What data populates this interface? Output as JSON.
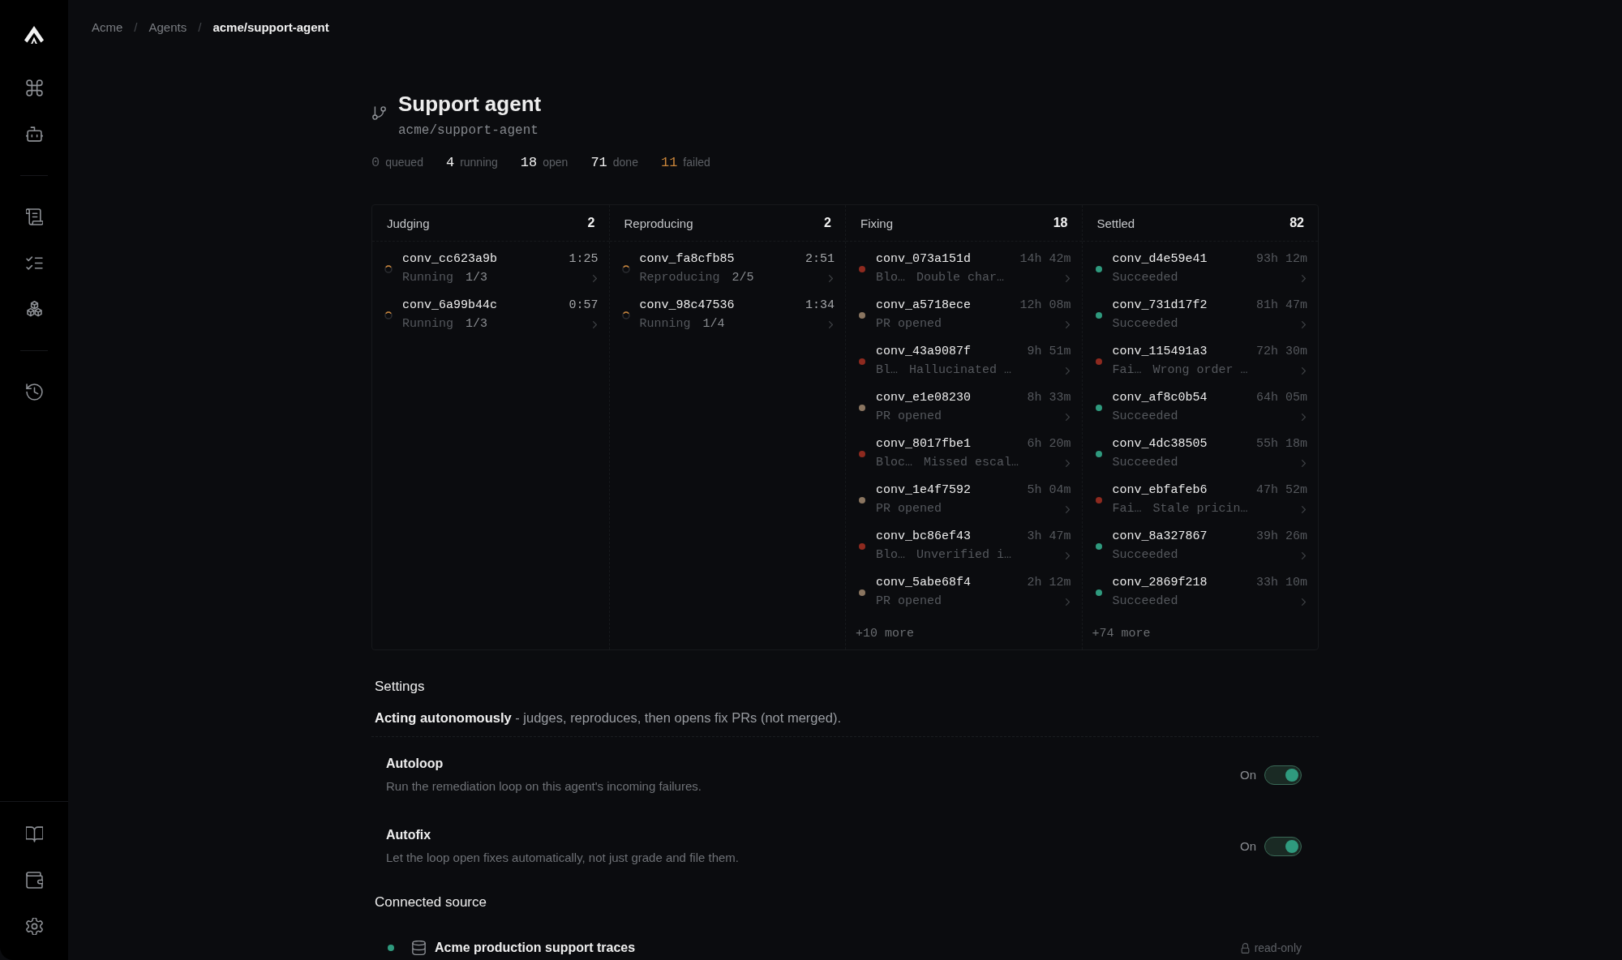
{
  "breadcrumb": [
    {
      "kind": "link",
      "label": "Acme"
    },
    {
      "kind": "separator",
      "label": "/"
    },
    {
      "kind": "link",
      "label": "Agents"
    },
    {
      "kind": "separator",
      "label": "/"
    },
    {
      "kind": "current",
      "label": "acme/support-agent"
    }
  ],
  "header": {
    "title": "Support agent",
    "repo": "acme/support-agent"
  },
  "stats": [
    {
      "count": "0",
      "caption": "queued",
      "color": "#55585d"
    },
    {
      "count": "4",
      "caption": "running",
      "color": "#f0f0f0"
    },
    {
      "count": "18",
      "caption": "open",
      "color": "#f0f0f0"
    },
    {
      "count": "71",
      "caption": "done",
      "color": "#f0f0f0"
    },
    {
      "count": "11",
      "caption": "failed",
      "color": "#c9853a"
    }
  ],
  "board": {
    "columns": [
      {
        "title": "Judging",
        "count": "2",
        "cards": [
          {
            "kind": "spinner",
            "id": "conv_cc623a9b",
            "time": "1:25",
            "status": "Running",
            "progress": "1/3"
          },
          {
            "kind": "spinner",
            "id": "conv_6a99b44c",
            "time": "0:57",
            "status": "Running",
            "progress": "1/3"
          }
        ]
      },
      {
        "title": "Reproducing",
        "count": "2",
        "cards": [
          {
            "kind": "spinner",
            "id": "conv_fa8cfb85",
            "time": "2:51",
            "status": "Reproducing",
            "progress": "2/5"
          },
          {
            "kind": "spinner",
            "id": "conv_98c47536",
            "time": "1:34",
            "status": "Running",
            "progress": "1/4"
          }
        ]
      },
      {
        "title": "Fixing",
        "count": "18",
        "cards": [
          {
            "kind": "dot",
            "color": "#8e2a1f",
            "id": "conv_073a151d",
            "time": "14h 42m",
            "status": "Blo…",
            "detail": "Double char…"
          },
          {
            "kind": "dot",
            "color": "#8a7560",
            "id": "conv_a5718ece",
            "time": "12h 08m",
            "status": "PR opened"
          },
          {
            "kind": "dot",
            "color": "#8e2a1f",
            "id": "conv_43a9087f",
            "time": "9h 51m",
            "status": "Bl…",
            "detail": "Hallucinated …"
          },
          {
            "kind": "dot",
            "color": "#8a7560",
            "id": "conv_e1e08230",
            "time": "8h 33m",
            "status": "PR opened"
          },
          {
            "kind": "dot",
            "color": "#8e2a1f",
            "id": "conv_8017fbe1",
            "time": "6h 20m",
            "status": "Bloc…",
            "detail": "Missed escal…"
          },
          {
            "kind": "dot",
            "color": "#8a7560",
            "id": "conv_1e4f7592",
            "time": "5h 04m",
            "status": "PR opened"
          },
          {
            "kind": "dot",
            "color": "#8e2a1f",
            "id": "conv_bc86ef43",
            "time": "3h 47m",
            "status": "Blo…",
            "detail": "Unverified i…"
          },
          {
            "kind": "dot",
            "color": "#8a7560",
            "id": "conv_5abe68f4",
            "time": "2h 12m",
            "status": "PR opened"
          }
        ],
        "more": "+10 more"
      },
      {
        "title": "Settled",
        "count": "82",
        "cards": [
          {
            "kind": "dot",
            "color": "#2f9a7e",
            "id": "conv_d4e59e41",
            "time": "93h 12m",
            "status": "Succeeded"
          },
          {
            "kind": "dot",
            "color": "#2f9a7e",
            "id": "conv_731d17f2",
            "time": "81h 47m",
            "status": "Succeeded"
          },
          {
            "kind": "dot",
            "color": "#8e2a1f",
            "id": "conv_115491a3",
            "time": "72h 30m",
            "status": "Fai…",
            "detail": "Wrong order …"
          },
          {
            "kind": "dot",
            "color": "#2f9a7e",
            "id": "conv_af8c0b54",
            "time": "64h 05m",
            "status": "Succeeded"
          },
          {
            "kind": "dot",
            "color": "#2f9a7e",
            "id": "conv_4dc38505",
            "time": "55h 18m",
            "status": "Succeeded"
          },
          {
            "kind": "dot",
            "color": "#8e2a1f",
            "id": "conv_ebfafeb6",
            "time": "47h 52m",
            "status": "Fai…",
            "detail": "Stale pricin…"
          },
          {
            "kind": "dot",
            "color": "#2f9a7e",
            "id": "conv_8a327867",
            "time": "39h 26m",
            "status": "Succeeded"
          },
          {
            "kind": "dot",
            "color": "#2f9a7e",
            "id": "conv_2869f218",
            "time": "33h 10m",
            "status": "Succeeded"
          }
        ],
        "more": "+74 more"
      }
    ]
  },
  "settings": {
    "title": "Settings",
    "summary": "**Acting autonomously** - judges, reproduces, then opens fix PRs (not merged).",
    "toggles": [
      {
        "title": "Autoloop",
        "description": "Run the remediation loop on this agent's incoming failures.",
        "state_label": "On",
        "on": true
      },
      {
        "title": "Autofix",
        "description": "Let the loop open fixes automatically, not just grade and file them.",
        "state_label": "On",
        "on": true
      }
    ]
  },
  "connected_source": {
    "title": "Connected source",
    "sources": [
      {
        "name": "Acme production support traces",
        "active": true,
        "access": "read-only"
      }
    ]
  }
}
